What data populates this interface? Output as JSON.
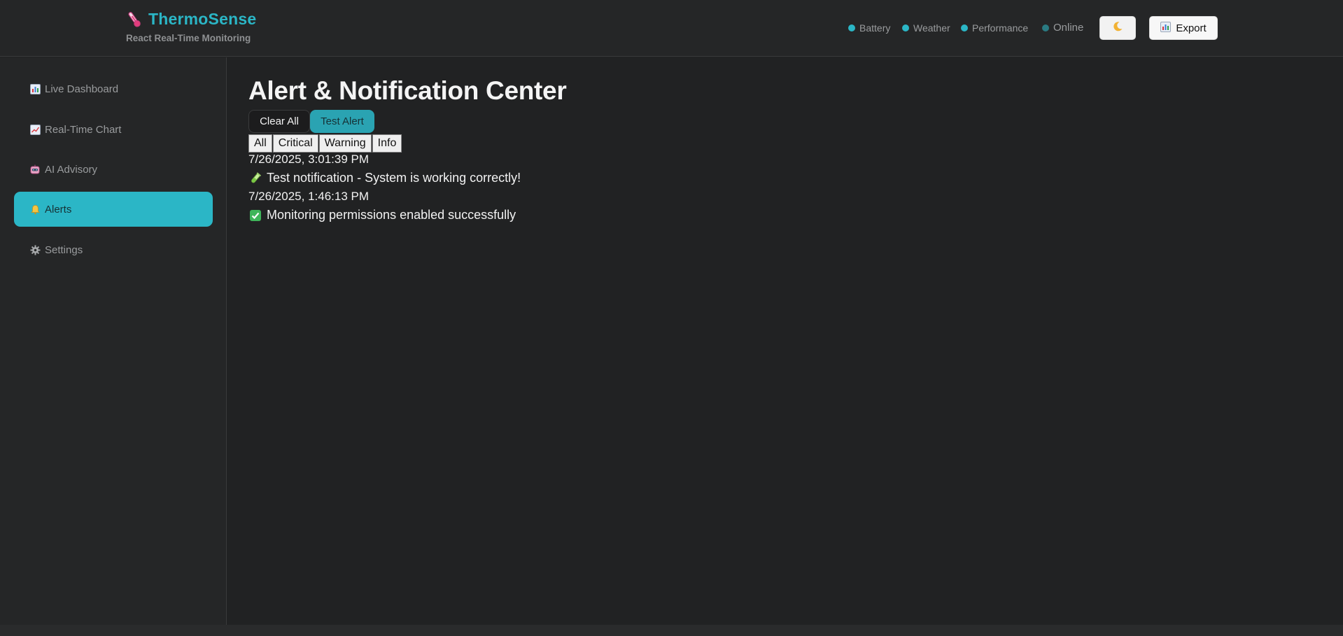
{
  "header": {
    "title": "ThermoSense",
    "subtitle": "React Real-Time Monitoring",
    "logo_icon": "thermometer-icon",
    "status": [
      {
        "label": "Battery",
        "icon": "status-dot-icon"
      },
      {
        "label": "Weather",
        "icon": "status-dot-icon"
      },
      {
        "label": "Performance",
        "icon": "status-dot-icon"
      },
      {
        "label": "Online",
        "icon": "status-dot-icon"
      }
    ],
    "theme_icon": "moon-icon",
    "export_label": "Export",
    "export_icon": "bar-chart-icon"
  },
  "sidebar": {
    "items": [
      {
        "label": "Live Dashboard",
        "icon": "bar-chart-icon",
        "active": false
      },
      {
        "label": "Real-Time Chart",
        "icon": "line-chart-icon",
        "active": false
      },
      {
        "label": "AI Advisory",
        "icon": "robot-icon",
        "active": false
      },
      {
        "label": "Alerts",
        "icon": "bell-icon",
        "active": true
      },
      {
        "label": "Settings",
        "icon": "gear-icon",
        "active": false
      }
    ]
  },
  "main": {
    "title": "Alert & Notification Center",
    "clear_all_label": "Clear All",
    "test_alert_label": "Test Alert",
    "filters": [
      "All",
      "Critical",
      "Warning",
      "Info"
    ],
    "alerts": [
      {
        "time": "7/26/2025, 3:01:39 PM",
        "message": "Test notification - System is working correctly!",
        "icon": "test-tube-icon"
      },
      {
        "time": "7/26/2025, 1:46:13 PM",
        "message": "Monitoring permissions enabled successfully",
        "icon": "check-box-icon"
      }
    ]
  },
  "colors": {
    "accent": "#2bb6c6",
    "background": "#212223",
    "panel": "#252627"
  }
}
